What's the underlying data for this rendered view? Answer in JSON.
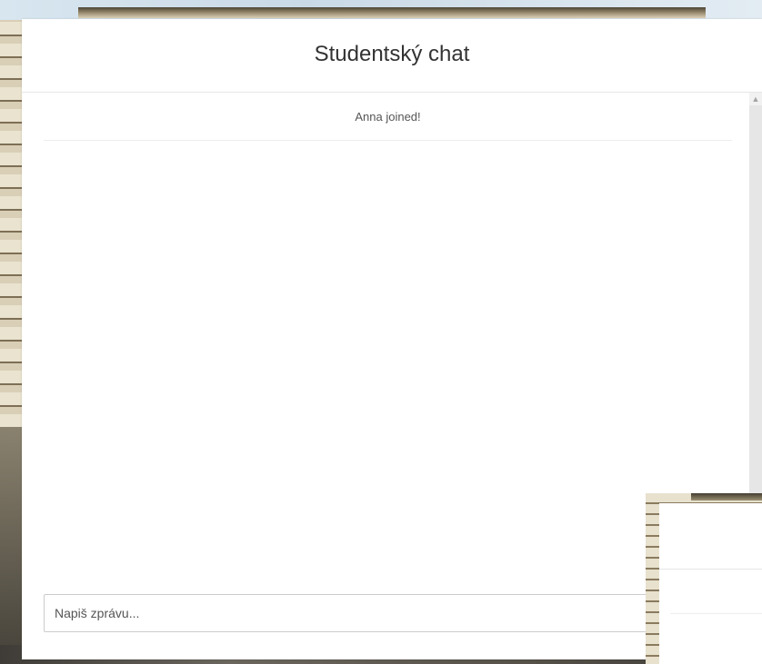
{
  "chat": {
    "title": "Studentský chat",
    "messages": [
      {
        "type": "system",
        "text": "Anna joined!"
      }
    ],
    "input": {
      "placeholder": "Napiš zprávu...",
      "value": ""
    }
  },
  "colors": {
    "panel_bg": "#ffffff",
    "header_border": "#e6e6e6",
    "text": "#333333",
    "system_text": "#555555",
    "input_border": "#cccccc"
  }
}
